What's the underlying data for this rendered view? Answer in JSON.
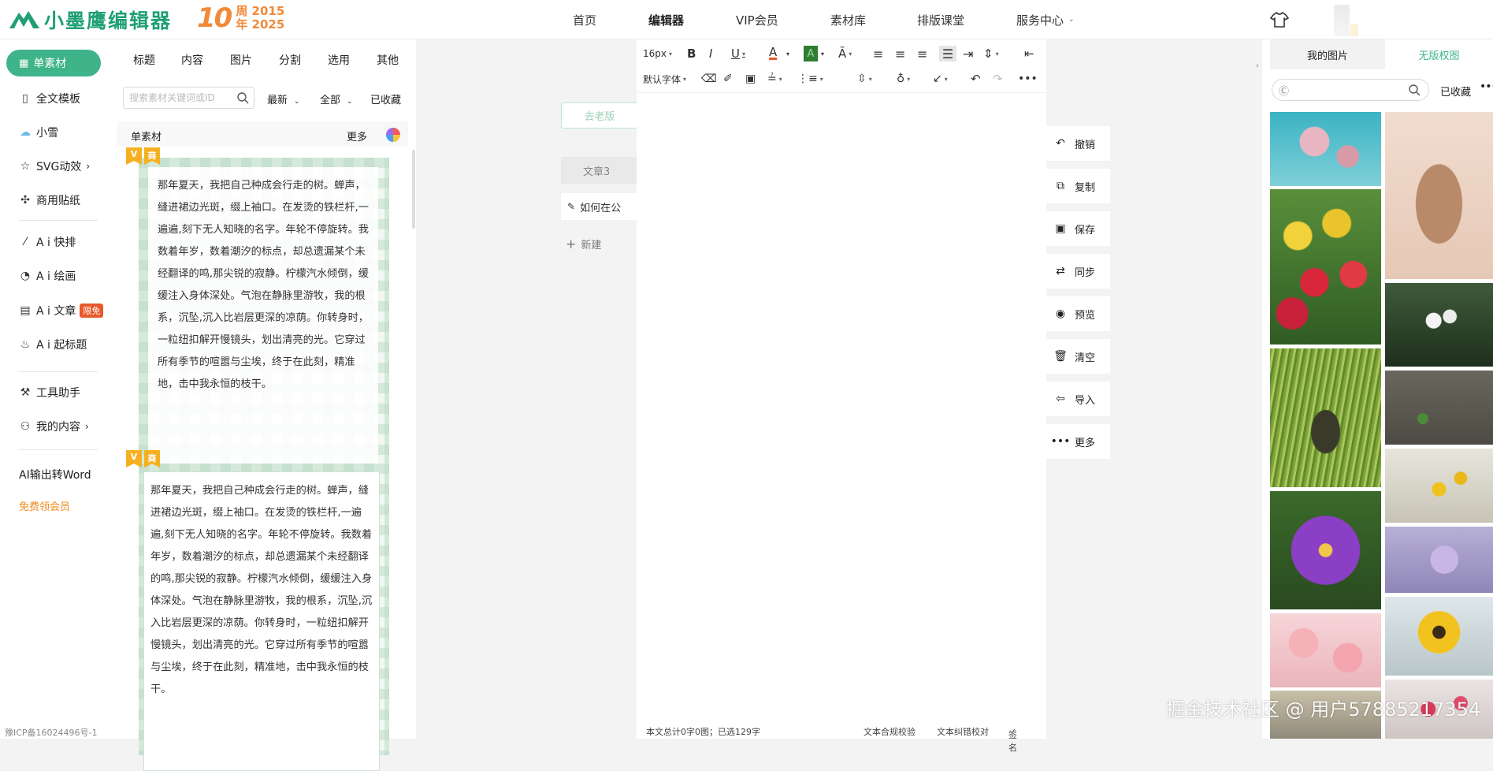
{
  "brand": {
    "name": "小墨鹰编辑器",
    "anniversary_number": "10",
    "anniversary_line1": "周 2015",
    "anniversary_line2": "年 2025"
  },
  "topnav": {
    "items": [
      "首页",
      "编辑器",
      "VIP会员",
      "素材库",
      "排版课堂",
      "服务中心"
    ],
    "active": "编辑器"
  },
  "leftnav": {
    "active": "单素材",
    "items": [
      "全文模板",
      "小雪",
      "SVG动效",
      "商用贴纸",
      "A i 快排",
      "A i 绘画",
      "A i 文章",
      "A i 起标题",
      "工具助手",
      "我的内容"
    ],
    "badge": "限免",
    "word_export": "AI输出转Word",
    "free_vip": "免费领会员",
    "icp": "豫ICP备16024496号-1"
  },
  "material": {
    "tabs": [
      "标题",
      "内容",
      "图片",
      "分割",
      "选用",
      "其他"
    ],
    "search_placeholder": "搜索素材关键词或ID",
    "filters": {
      "sort": "最新",
      "scope": "全部",
      "saved": "已收藏"
    },
    "section_title": "单素材",
    "section_more": "更多",
    "tag_v": "V",
    "tag_shang": "商",
    "card1_text": "那年夏天，我把自己种成会行走的树。蝉声，缝进裙边光斑，缀上袖口。在发烫的铁栏杆,一遍遍,刻下无人知晓的名字。年轮不停旋转。我数着年岁，数着潮汐的标点，却总遗漏某个未经翻译的鸣,那尖锐的寂静。柠檬汽水倾倒，缓缓注入身体深处。气泡在静脉里游牧，我的根系，沉坠,沉入比岩层更深的凉荫。你转身时，一粒纽扣解开慢镜头，划出清亮的光。它穿过所有季节的喧嚣与尘埃，终于在此刻，精准地，击中我永恒的枝干。",
    "card2_text": "那年夏天，我把自己种成会行走的树。蝉声，缝进裙边光斑，缀上袖口。在发烫的铁栏杆,一遍遍,刻下无人知晓的名字。年轮不停旋转。我数着年岁，数着潮汐的标点，却总遗漏某个未经翻译的鸣,那尖锐的寂静。柠檬汽水倾倒，缓缓注入身体深处。气泡在静脉里游牧，我的根系，沉坠,沉入比岩层更深的凉荫。你转身时，一粒纽扣解开慢镜头，划出清亮的光。它穿过所有季节的喧嚣与尘埃，终于在此刻，精准地，击中我永恒的枝干。"
  },
  "docs": {
    "old_version": "去老版",
    "tabs": [
      "文章3",
      "如何在公",
      "新建"
    ]
  },
  "toolbar": {
    "font_size": "16px",
    "font_family": "默认字体",
    "highlight_color": "#2e7d32",
    "font_color": "#e8592b"
  },
  "status": {
    "count": "本文总计0字0图；已选129字",
    "compliance": "文本合规校验",
    "typo": "文本纠错校对",
    "sign": "签名"
  },
  "actions": [
    "撤销",
    "复制",
    "保存",
    "同步",
    "预览",
    "清空",
    "导入",
    "更多"
  ],
  "images": {
    "tabs": [
      "我的图片",
      "无版权图"
    ],
    "search_placeholder": "Ⓒ",
    "saved": "已收藏",
    "more": "•••",
    "thumbnails": [
      "pink-blossom",
      "dried-flowers",
      "tulips",
      "snowdrops",
      "man-in-grass",
      "sprout",
      "purple-primrose",
      "yellow-flowers",
      "lilac",
      "pink-blossom-2",
      "sunflower",
      "cherry-branch",
      "stone"
    ]
  },
  "watermark": "掘金技术社区 @ 用户57885217354",
  "colors": {
    "accent": "#3fb389",
    "orange": "#f08a3a",
    "badge": "#e8592b"
  }
}
